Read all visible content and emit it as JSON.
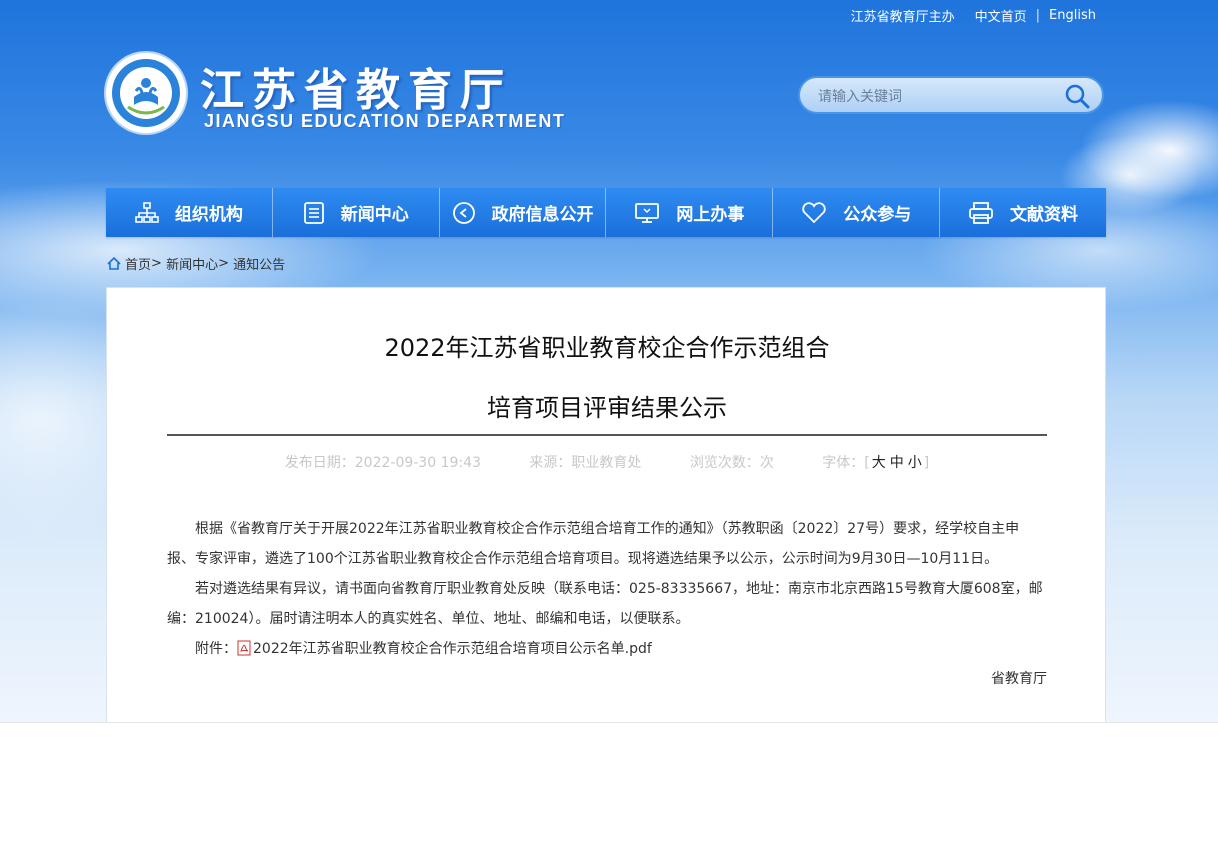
{
  "top_links": {
    "host": "江苏省教育厅主办",
    "home_cn": "中文首页",
    "english": "English"
  },
  "logo": {
    "title": "江苏省教育厅",
    "subtitle": "JIANGSU EDUCATION DEPARTMENT"
  },
  "search": {
    "placeholder": "请输入关键词"
  },
  "nav": [
    {
      "label": "组织机构",
      "icon": "org-chart-icon"
    },
    {
      "label": "新闻中心",
      "icon": "document-icon"
    },
    {
      "label": "政府信息公开",
      "icon": "play-circle-icon"
    },
    {
      "label": "网上办事",
      "icon": "monitor-icon"
    },
    {
      "label": "公众参与",
      "icon": "heart-icon"
    },
    {
      "label": "文献资料",
      "icon": "printer-icon"
    }
  ],
  "breadcrumb": {
    "home": "首页",
    "sep": ">",
    "section": "新闻中心",
    "current": "通知公告"
  },
  "article": {
    "title_line1": "2022年江苏省职业教育校企合作示范组合",
    "title_line2": "培育项目评审结果公示",
    "publish_date": "发布日期：2022-09-30 19:43",
    "source": "来源：职业教育处",
    "views": "浏览次数：次",
    "font_label": "字体：",
    "font_open": "[",
    "font_large": "大",
    "font_medium": "中",
    "font_small": "小",
    "font_close": "]",
    "para1": "根据《省教育厅关于开展2022年江苏省职业教育校企合作示范组合培育工作的通知》（苏教职函〔2022〕27号）要求，经学校自主申报、专家评审，遴选了100个江苏省职业教育校企合作示范组合培育项目。现将遴选结果予以公示，公示时间为9月30日—10月11日。",
    "para2": "若对遴选结果有异议，请书面向省教育厅职业教育处反映（联系电话：025-83335667，地址：南京市北京西路15号教育大厦608室，邮编：210024）。届时请注明本人的真实姓名、单位、地址、邮编和电话，以便联系。",
    "attachment_label": "附件：",
    "attachment_file": "2022年江苏省职业教育校企合作示范组合培育项目公示名单.pdf",
    "signature": "省教育厅"
  }
}
